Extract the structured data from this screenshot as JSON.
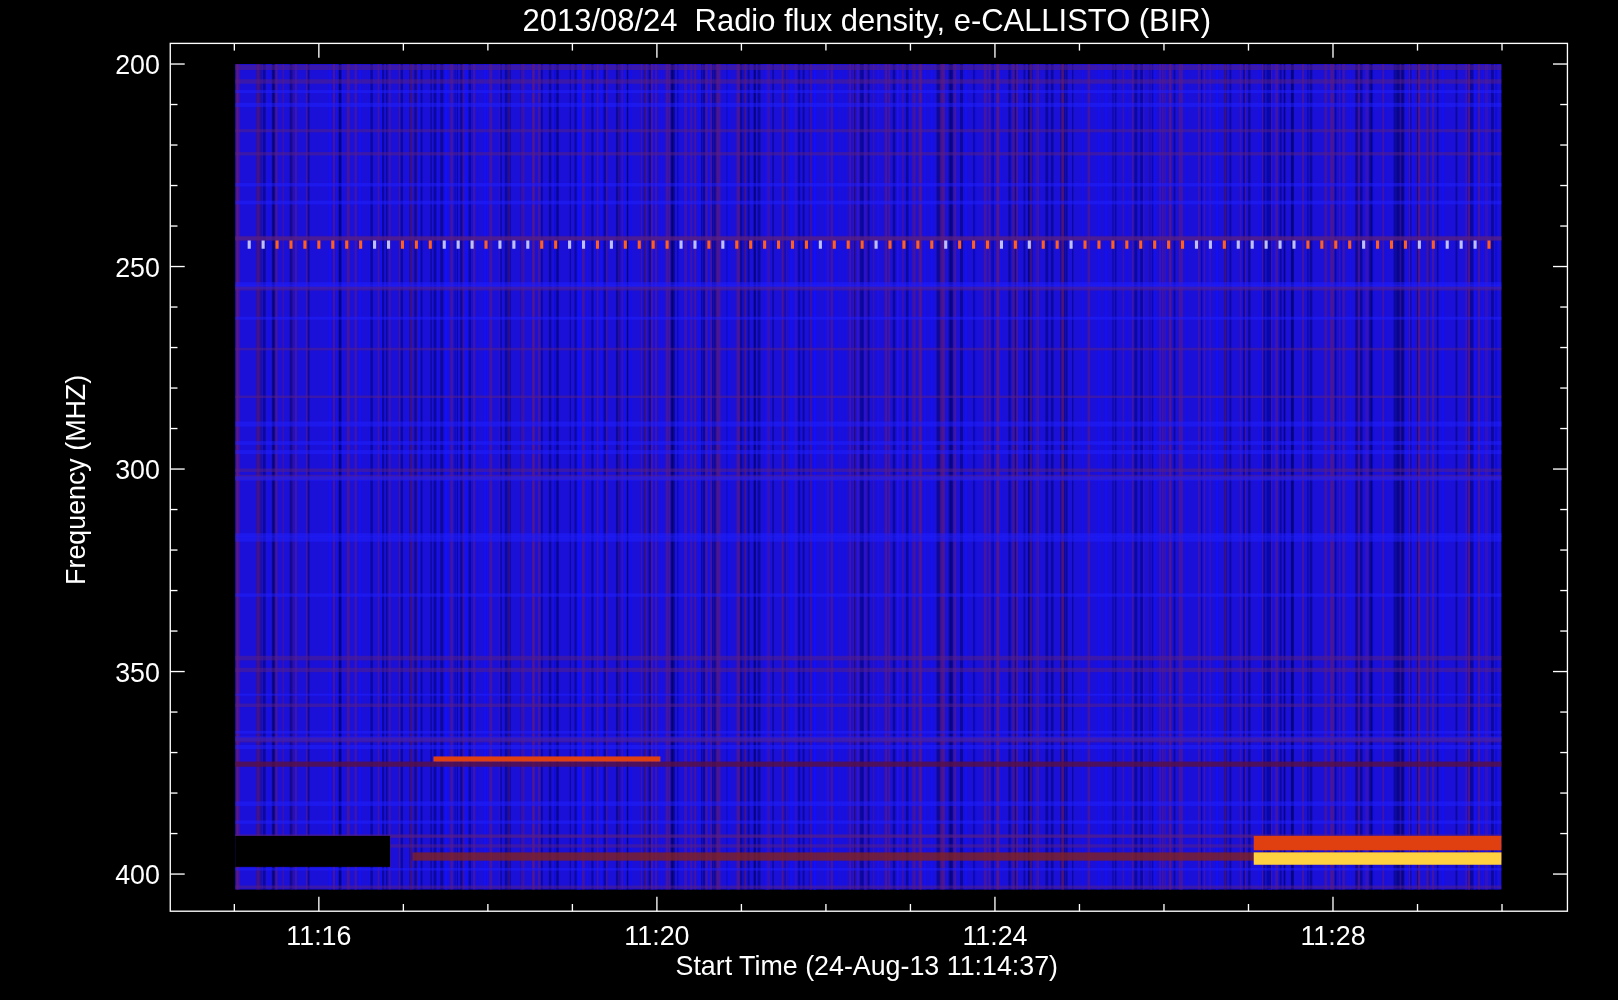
{
  "plot": {
    "title": "2013/08/24  Radio flux density, e-CALLISTO (BIR)",
    "y_axis": {
      "label": "Frequency (MHZ)",
      "ticks": [
        "200",
        "250",
        "300",
        "350",
        "400"
      ]
    },
    "x_axis": {
      "label": "Start Time (24-Aug-13 11:14:37)",
      "ticks": [
        "11:16",
        "11:20",
        "11:24",
        "11:28"
      ]
    }
  }
}
